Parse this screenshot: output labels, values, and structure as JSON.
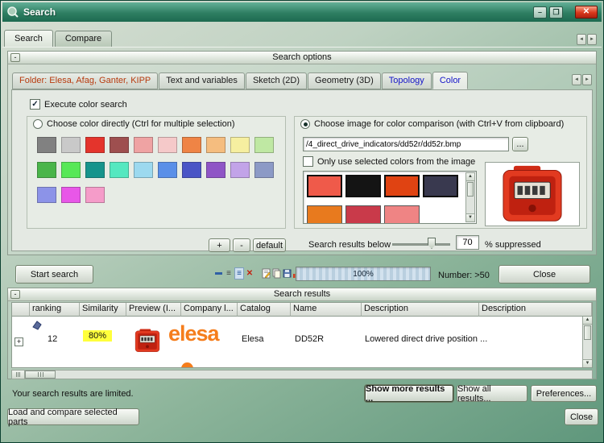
{
  "window": {
    "title": "Search"
  },
  "icons": {
    "minimize": "–",
    "maximize": "❐",
    "close": "✕",
    "arrow_left": "◄",
    "arrow_right": "►",
    "arrow_up": "▲",
    "arrow_down": "▼",
    "list": "≡",
    "details": "≡",
    "delete": "✕",
    "expander": "+"
  },
  "main_tabs": [
    {
      "label": "Search"
    },
    {
      "label": "Compare"
    }
  ],
  "search_options": {
    "title": "Search options",
    "collapse_label": "-",
    "tabs": [
      {
        "label": "Folder: Elesa, Afag, Ganter, KIPP",
        "color": "#b73a0e",
        "active": false
      },
      {
        "label": "Text and variables",
        "color": "#1a1a1a",
        "active": false
      },
      {
        "label": "Sketch (2D)",
        "color": "#1a1a1a",
        "active": false
      },
      {
        "label": "Geometry (3D)",
        "color": "#1a1a1a",
        "active": false
      },
      {
        "label": "Topology",
        "color": "#1414c8",
        "active": false
      },
      {
        "label": "Color",
        "color": "#1414c8",
        "active": true
      }
    ],
    "execute_label": "Execute color search",
    "execute_checked": true,
    "direct_color": {
      "radio_label": "Choose color directly (Ctrl for multiple selection)",
      "selected": false,
      "swatches": [
        [
          "#818181",
          "#c9c9c9",
          "#e4342c",
          "#9e4f4f",
          "#efa3a3",
          "#f5c9c9",
          "#ef8445",
          "#f5bd7f",
          "#f6efa0",
          "#bfe8a3"
        ],
        [
          "#4ab54a",
          "#57e857",
          "#16948c",
          "#55e8c0",
          "#9cd9ef",
          "#5a8fe8",
          "#4a55c6",
          "#8f55c6",
          "#c2a3e8",
          "#8c9ac6"
        ],
        [
          "#8c93e8",
          "#e857e8",
          "#f59cc9"
        ]
      ],
      "add_label": "+",
      "remove_label": "-",
      "default_label": "default"
    },
    "image_compare": {
      "radio_label": "Choose image for color comparison (with Ctrl+V from clipboard)",
      "selected": true,
      "path_value": "/4_direct_drive_indicators/dd52r/dd52r.bmp",
      "browse_label": "...",
      "only_selected_label": "Only use selected colors from the image",
      "only_selected_checked": false,
      "image_colors": [
        "#ef5a4a",
        "#141414",
        "#e04312",
        "#39394f"
      ],
      "image_colors_partial": [
        "#e87a1e",
        "#c93a4a",
        "#ef8484"
      ]
    },
    "suppress": {
      "label_before": "Search results below",
      "value": "70",
      "label_after": "% suppressed"
    }
  },
  "toolbar": {
    "start_search_label": "Start search",
    "icon_names": [
      "collapse-icon",
      "list-view-icon",
      "details-view-icon",
      "delete-icon",
      "edit-doc-icon",
      "copy-doc-icon",
      "save-icon",
      "statistics-icon"
    ],
    "progress_value": "100%",
    "number_label": "Number: >50",
    "close_label": "Close"
  },
  "results": {
    "title": "Search results",
    "collapse_label": "-",
    "columns": [
      "",
      "ranking",
      "Similarity",
      "Preview (I...",
      "Company l...",
      "Catalog",
      "Name",
      "Description",
      "Description"
    ],
    "row": {
      "ranking": "12",
      "similarity": "80%",
      "similarity_bg": "#ffff3c",
      "company_logo_text": "elesa",
      "catalog": "Elesa",
      "name": "DD52R",
      "description": "Lowered direct drive position ..."
    }
  },
  "status": {
    "message": "Your search results are limited.",
    "show_more_label": "Show more results ...",
    "show_all_label": "Show all results...",
    "preferences_label": "Preferences..."
  },
  "footer": {
    "load_compare_label": "Load and compare selected parts",
    "close_label": "Close"
  }
}
